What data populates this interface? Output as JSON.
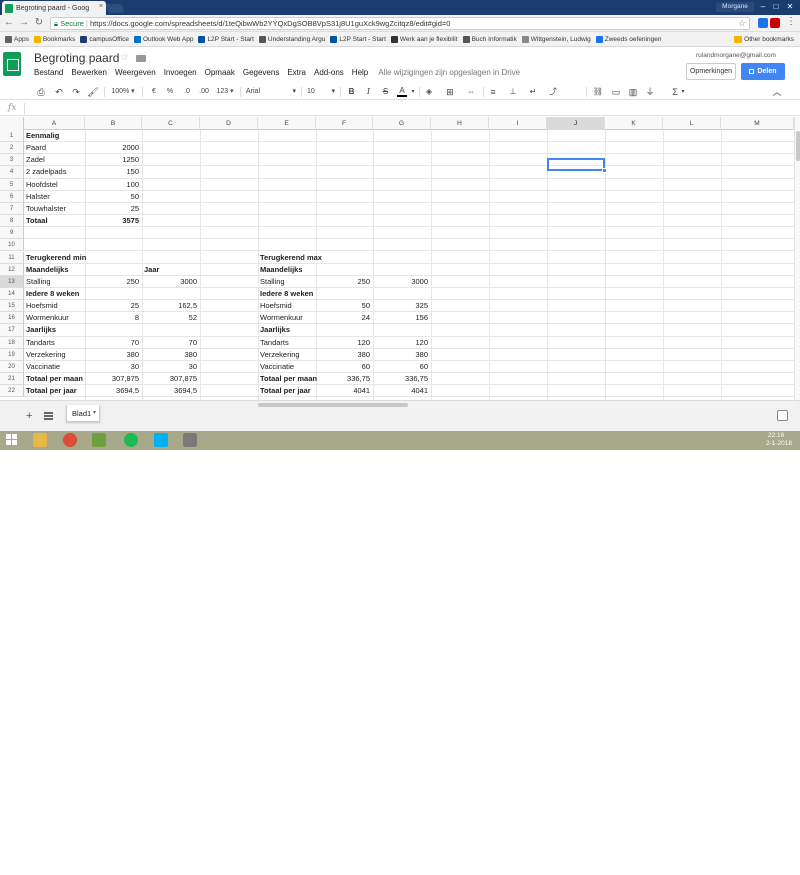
{
  "browser": {
    "tab_title": "Begroting paard - Goog",
    "tab_close": "×",
    "profile": "Morgane",
    "secure_label": "Secure",
    "url": "https://docs.google.com/spreadsheets/d/1teQibwWb2YYQxDgSOB8VpS31j8U1guXck9wgZcitqz8/edit#gid=0",
    "bookmarks": [
      {
        "label": "Apps",
        "color": "#5f6368"
      },
      {
        "label": "Bookmarks",
        "color": "#f4b400"
      },
      {
        "label": "campusOffice",
        "color": "#1a3c6e"
      },
      {
        "label": "Outlook Web App",
        "color": "#0072c6"
      },
      {
        "label": "L2P Start - Start",
        "color": "#00549f"
      },
      {
        "label": "Understanding Argu",
        "color": "#555555"
      },
      {
        "label": "L2P Start - Start",
        "color": "#00549f"
      },
      {
        "label": "Werk aan je flexibilit",
        "color": "#333333"
      },
      {
        "label": "Buch Informatik",
        "color": "#555555"
      },
      {
        "label": "Wittgenstein, Ludwig",
        "color": "#888888"
      },
      {
        "label": "Zweeds oefeningen",
        "color": "#1a73e8"
      }
    ],
    "other_bookmarks": "Other bookmarks"
  },
  "sheets": {
    "title": "Begroting paard",
    "user_email": "rulandmorgane@gmail.com",
    "menus": [
      "Bestand",
      "Bewerken",
      "Weergeven",
      "Invoegen",
      "Opmaak",
      "Gegevens",
      "Extra",
      "Add-ons",
      "Help"
    ],
    "save_status": "Alle wijzigingen zijn opgeslagen in Drive",
    "comments_label": "Opmerkingen",
    "share_label": "Delen",
    "fx": "fx"
  },
  "toolbar": {
    "zoom": "100%",
    "currency": "€",
    "percent": "%",
    "dec_dec": ".0",
    "dec_inc": ".00",
    "format": "123",
    "font": "Arial",
    "font_size": "10",
    "bold": "B",
    "italic": "I",
    "strike": "S",
    "text_color": "A",
    "sigma": "Σ"
  },
  "columns": [
    "A",
    "B",
    "C",
    "D",
    "E",
    "F",
    "G",
    "H",
    "I",
    "J",
    "K",
    "L",
    "M"
  ],
  "rows": [
    "1",
    "2",
    "3",
    "4",
    "5",
    "6",
    "7",
    "8",
    "9",
    "10",
    "11",
    "12",
    "13",
    "14",
    "15",
    "16",
    "17",
    "18",
    "19",
    "20",
    "21",
    "22"
  ],
  "cells": {
    "A1": "Eenmalig",
    "A2": "Paard",
    "B2": "2000",
    "A3": "Zadel",
    "B3": "1250",
    "A4": "2 zadelpads",
    "B4": "150",
    "A5": "Hoofdstel",
    "B5": "100",
    "A6": "Halster",
    "B6": "50",
    "A7": "Touwhalster",
    "B7": "25",
    "A8": "Totaal",
    "B8": "3575",
    "A11": "Terugkerend min",
    "A12": "Maandelijks",
    "C12": "Jaar",
    "A13": "Stalling",
    "B13": "250",
    "C13": "3000",
    "A14": "Iedere 8 weken",
    "A15": "Hoefsmid",
    "B15": "25",
    "C15": "162,5",
    "A16": "Wormenkuur",
    "B16": "8",
    "C16": "52",
    "A17": "Jaarlijks",
    "A18": "Tandarts",
    "B18": "70",
    "C18": "70",
    "A19": "Verzekering",
    "B19": "380",
    "C19": "380",
    "A20": "Vaccinatie",
    "B20": "30",
    "C20": "30",
    "A21": "Totaal per maan",
    "B21": "307,875",
    "C21": "307,875",
    "A22": "Totaal per jaar",
    "B22": "3694,5",
    "C22": "3694,5",
    "E11": "Terugkerend max",
    "E12": "Maandelijks",
    "E13": "Stalling",
    "F13": "250",
    "G13": "3000",
    "E14": "Iedere 8 weken",
    "E15": "Hoefsmid",
    "F15": "50",
    "G15": "325",
    "E16": "Wormenkuur",
    "F16": "24",
    "G16": "156",
    "E17": "Jaarlijks",
    "E18": "Tandarts",
    "F18": "120",
    "G18": "120",
    "E19": "Verzekering",
    "F19": "380",
    "G19": "380",
    "E20": "Vaccinatie",
    "F20": "60",
    "G20": "60",
    "E21": "Totaal per maan",
    "F21": "336,75",
    "G21": "336,75",
    "E22": "Totaal per jaar",
    "F22": "4041",
    "G22": "4041"
  },
  "bold_cells": [
    "A1",
    "A8",
    "A11",
    "A12",
    "C12",
    "A14",
    "A17",
    "A21",
    "A22",
    "B8",
    "E11",
    "E12",
    "E14",
    "E17",
    "E21",
    "E22"
  ],
  "selected_cell": "J13",
  "sheet_tab": "Blad1",
  "taskbar": {
    "time": "22:16",
    "date": "2-1-2018"
  }
}
